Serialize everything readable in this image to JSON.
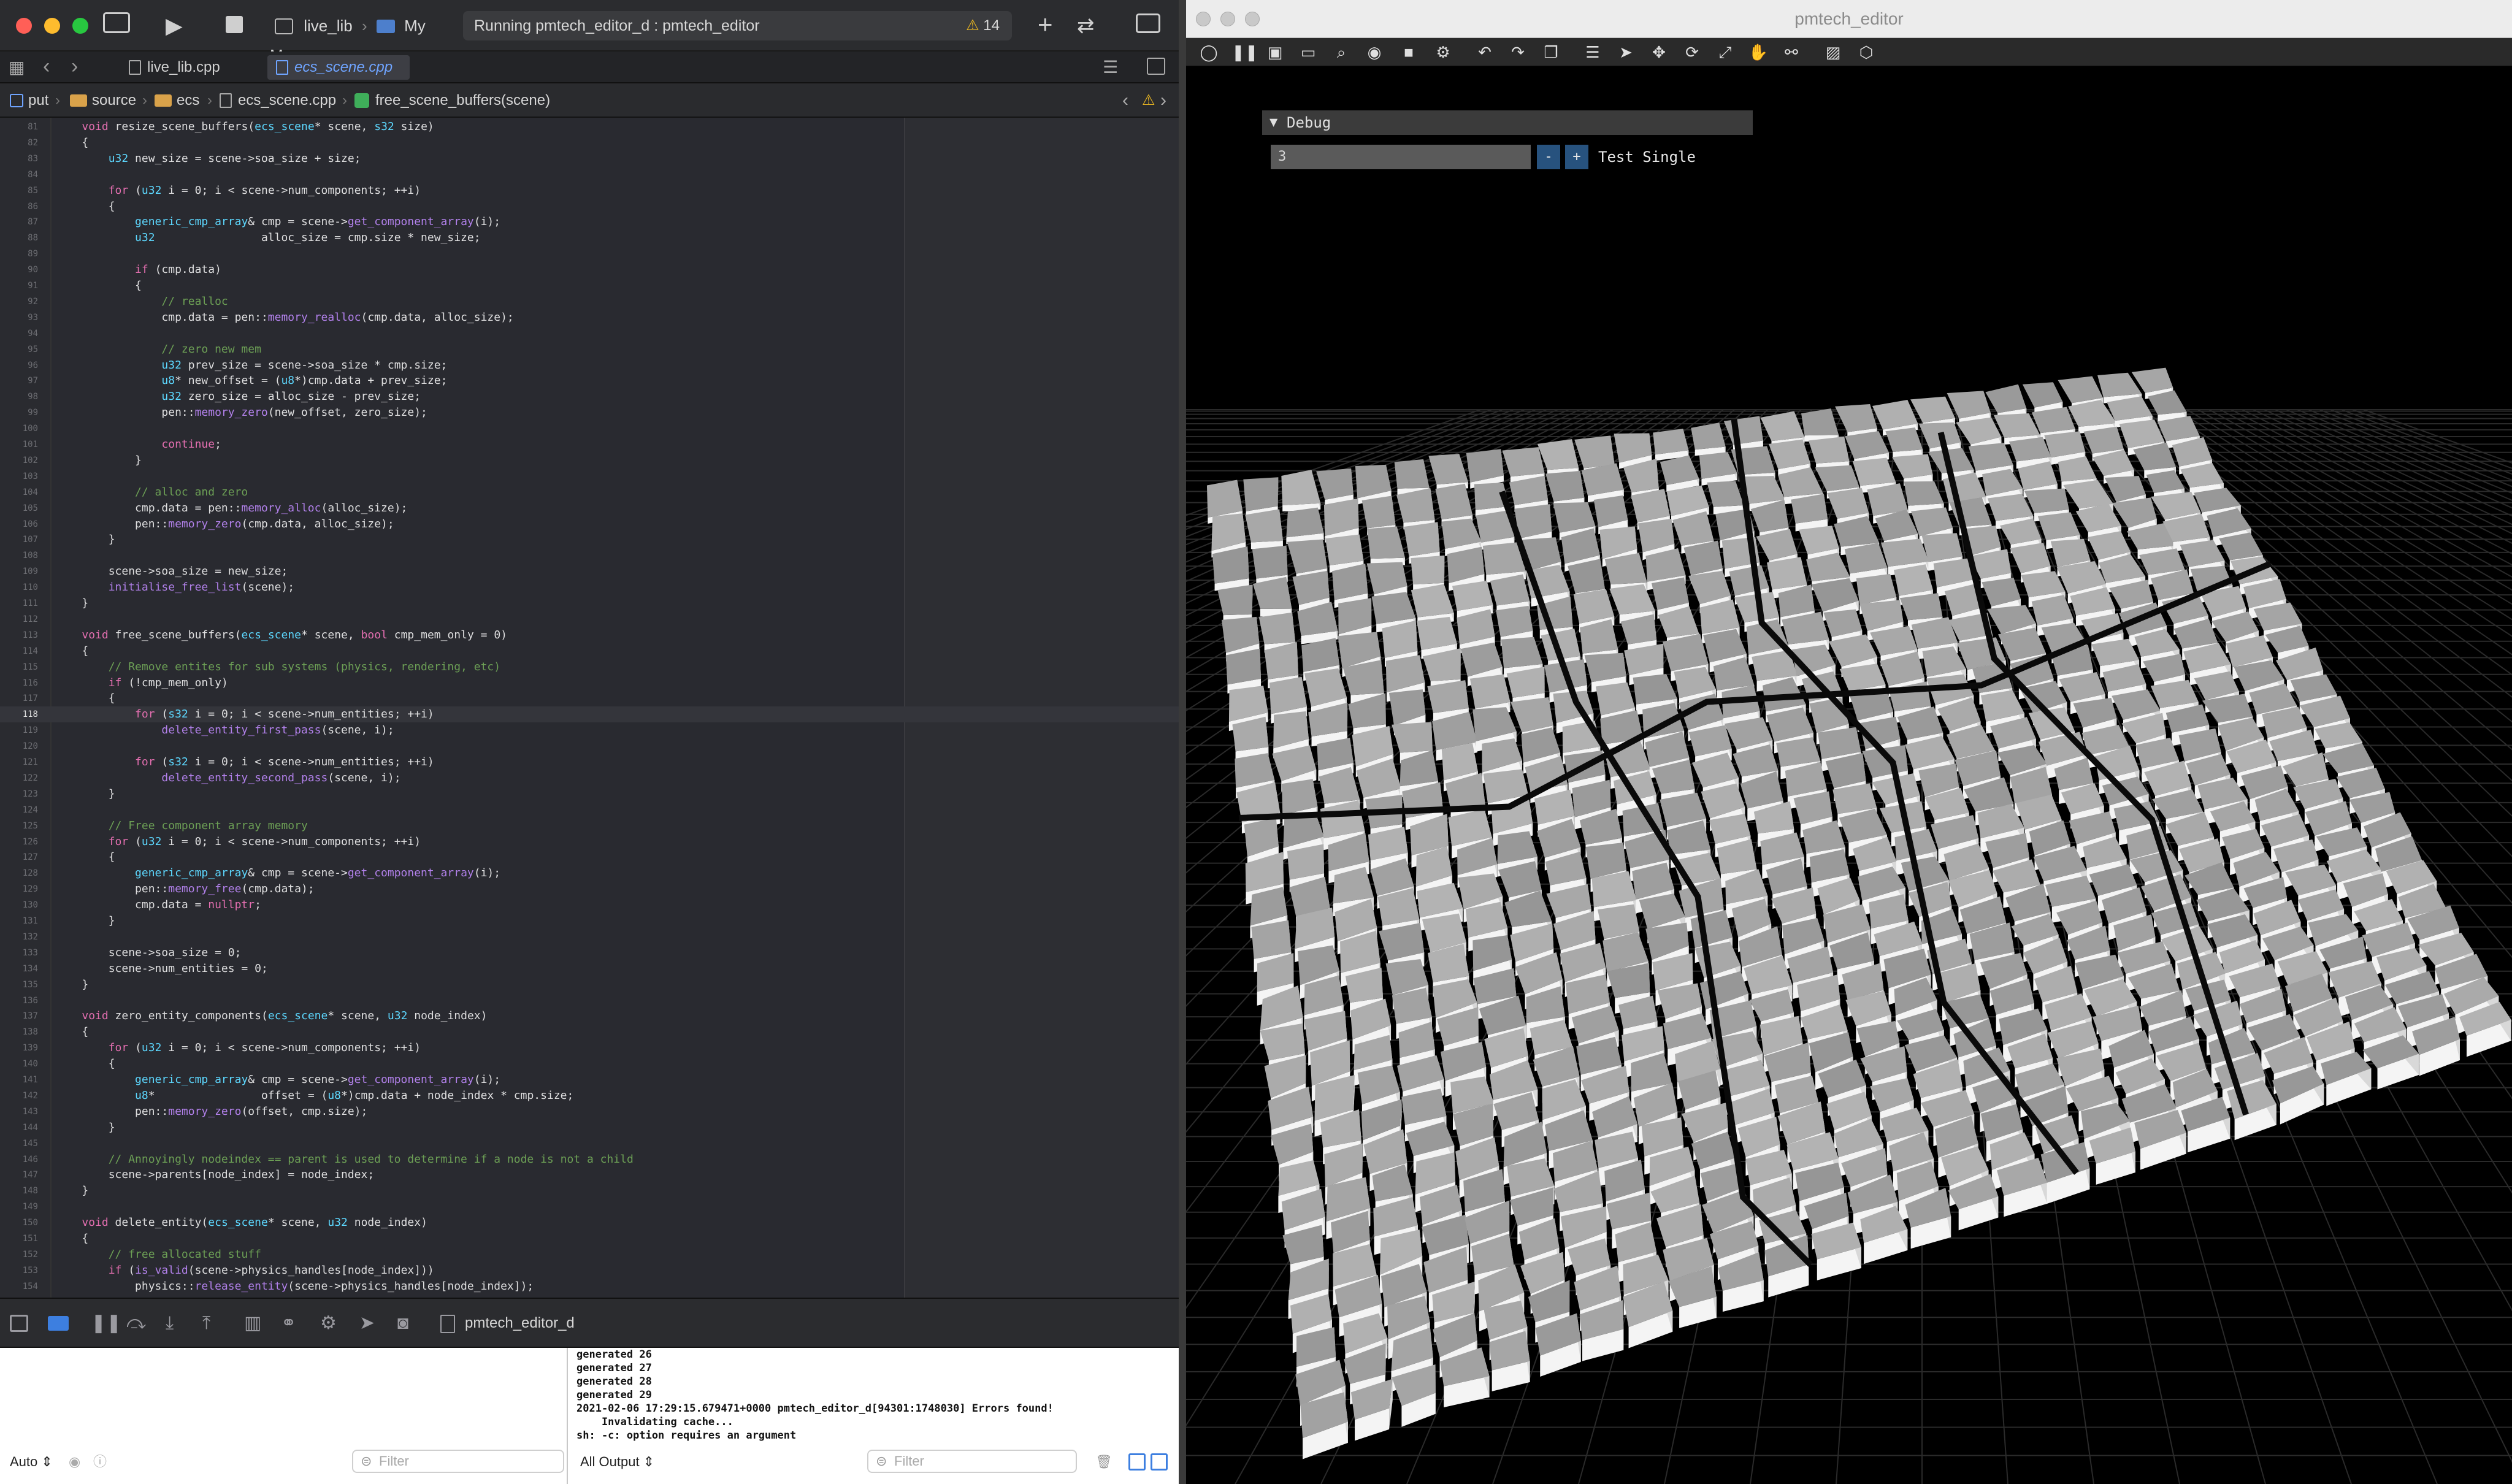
{
  "xcode": {
    "scheme": {
      "project": "live_lib",
      "destination": "My Mac"
    },
    "status": {
      "text": "Running pmtech_editor_d : pmtech_editor",
      "warnings": "14"
    },
    "tabs": [
      {
        "label": "live_lib.cpp"
      },
      {
        "label": "ecs_scene.cpp"
      }
    ],
    "breadcrumb": [
      "put",
      "source",
      "ecs",
      "ecs_scene.cpp",
      "free_scene_buffers(scene)"
    ],
    "code": [
      {
        "n": "81",
        "t": "    void resize_scene_buffers(ecs_scene* scene, s32 size)"
      },
      {
        "n": "82",
        "t": "    {"
      },
      {
        "n": "83",
        "t": "        u32 new_size = scene->soa_size + size;"
      },
      {
        "n": "84",
        "t": ""
      },
      {
        "n": "85",
        "t": "        for (u32 i = 0; i < scene->num_components; ++i)"
      },
      {
        "n": "86",
        "t": "        {"
      },
      {
        "n": "87",
        "t": "            generic_cmp_array& cmp = scene->get_component_array(i);"
      },
      {
        "n": "88",
        "t": "            u32                alloc_size = cmp.size * new_size;"
      },
      {
        "n": "89",
        "t": ""
      },
      {
        "n": "90",
        "t": "            if (cmp.data)"
      },
      {
        "n": "91",
        "t": "            {"
      },
      {
        "n": "92",
        "t": "                // realloc"
      },
      {
        "n": "93",
        "t": "                cmp.data = pen::memory_realloc(cmp.data, alloc_size);"
      },
      {
        "n": "94",
        "t": ""
      },
      {
        "n": "95",
        "t": "                // zero new mem"
      },
      {
        "n": "96",
        "t": "                u32 prev_size = scene->soa_size * cmp.size;"
      },
      {
        "n": "97",
        "t": "                u8* new_offset = (u8*)cmp.data + prev_size;"
      },
      {
        "n": "98",
        "t": "                u32 zero_size = alloc_size - prev_size;"
      },
      {
        "n": "99",
        "t": "                pen::memory_zero(new_offset, zero_size);"
      },
      {
        "n": "100",
        "t": ""
      },
      {
        "n": "101",
        "t": "                continue;"
      },
      {
        "n": "102",
        "t": "            }"
      },
      {
        "n": "103",
        "t": ""
      },
      {
        "n": "104",
        "t": "            // alloc and zero"
      },
      {
        "n": "105",
        "t": "            cmp.data = pen::memory_alloc(alloc_size);"
      },
      {
        "n": "106",
        "t": "            pen::memory_zero(cmp.data, alloc_size);"
      },
      {
        "n": "107",
        "t": "        }"
      },
      {
        "n": "108",
        "t": ""
      },
      {
        "n": "109",
        "t": "        scene->soa_size = new_size;"
      },
      {
        "n": "110",
        "t": "        initialise_free_list(scene);"
      },
      {
        "n": "111",
        "t": "    }"
      },
      {
        "n": "112",
        "t": ""
      },
      {
        "n": "113",
        "t": "    void free_scene_buffers(ecs_scene* scene, bool cmp_mem_only = 0)"
      },
      {
        "n": "114",
        "t": "    {"
      },
      {
        "n": "115",
        "t": "        // Remove entites for sub systems (physics, rendering, etc)"
      },
      {
        "n": "116",
        "t": "        if (!cmp_mem_only)"
      },
      {
        "n": "117",
        "t": "        {"
      },
      {
        "n": "118",
        "t": "            for (s32 i = 0; i < scene->num_entities; ++i)"
      },
      {
        "n": "119",
        "t": "                delete_entity_first_pass(scene, i);"
      },
      {
        "n": "120",
        "t": ""
      },
      {
        "n": "121",
        "t": "            for (s32 i = 0; i < scene->num_entities; ++i)"
      },
      {
        "n": "122",
        "t": "                delete_entity_second_pass(scene, i);"
      },
      {
        "n": "123",
        "t": "        }"
      },
      {
        "n": "124",
        "t": ""
      },
      {
        "n": "125",
        "t": "        // Free component array memory"
      },
      {
        "n": "126",
        "t": "        for (u32 i = 0; i < scene->num_components; ++i)"
      },
      {
        "n": "127",
        "t": "        {"
      },
      {
        "n": "128",
        "t": "            generic_cmp_array& cmp = scene->get_component_array(i);"
      },
      {
        "n": "129",
        "t": "            pen::memory_free(cmp.data);"
      },
      {
        "n": "130",
        "t": "            cmp.data = nullptr;"
      },
      {
        "n": "131",
        "t": "        }"
      },
      {
        "n": "132",
        "t": ""
      },
      {
        "n": "133",
        "t": "        scene->soa_size = 0;"
      },
      {
        "n": "134",
        "t": "        scene->num_entities = 0;"
      },
      {
        "n": "135",
        "t": "    }"
      },
      {
        "n": "136",
        "t": ""
      },
      {
        "n": "137",
        "t": "    void zero_entity_components(ecs_scene* scene, u32 node_index)"
      },
      {
        "n": "138",
        "t": "    {"
      },
      {
        "n": "139",
        "t": "        for (u32 i = 0; i < scene->num_components; ++i)"
      },
      {
        "n": "140",
        "t": "        {"
      },
      {
        "n": "141",
        "t": "            generic_cmp_array& cmp = scene->get_component_array(i);"
      },
      {
        "n": "142",
        "t": "            u8*                offset = (u8*)cmp.data + node_index * cmp.size;"
      },
      {
        "n": "143",
        "t": "            pen::memory_zero(offset, cmp.size);"
      },
      {
        "n": "144",
        "t": "        }"
      },
      {
        "n": "145",
        "t": ""
      },
      {
        "n": "146",
        "t": "        // Annoyingly nodeindex == parent is used to determine if a node is not a child"
      },
      {
        "n": "147",
        "t": "        scene->parents[node_index] = node_index;"
      },
      {
        "n": "148",
        "t": "    }"
      },
      {
        "n": "149",
        "t": ""
      },
      {
        "n": "150",
        "t": "    void delete_entity(ecs_scene* scene, u32 node_index)"
      },
      {
        "n": "151",
        "t": "    {"
      },
      {
        "n": "152",
        "t": "        // free allocated stuff"
      },
      {
        "n": "153",
        "t": "        if (is_valid(scene->physics_handles[node_index]))"
      },
      {
        "n": "154",
        "t": "            physics::release_entity(scene->physics_handles[node_index]);"
      }
    ],
    "debug_target": "pmtech_editor_d",
    "console_lines": [
      "generated 26",
      "generated 27",
      "generated 28",
      "generated 29",
      "2021-02-06 17:29:15.679471+0000 pmtech_editor_d[94301:1748030] Errors found!",
      "    Invalidating cache...",
      "sh: -c: option requires an argument"
    ],
    "vars_mode": "Auto",
    "output_mode": "All Output",
    "filter_placeholder": "Filter"
  },
  "editor_window": {
    "title": "pmtech_editor",
    "debug_panel": {
      "header": "Debug",
      "input_value": "3",
      "minus": "-",
      "plus": "+",
      "button_label": "Test Single"
    }
  }
}
